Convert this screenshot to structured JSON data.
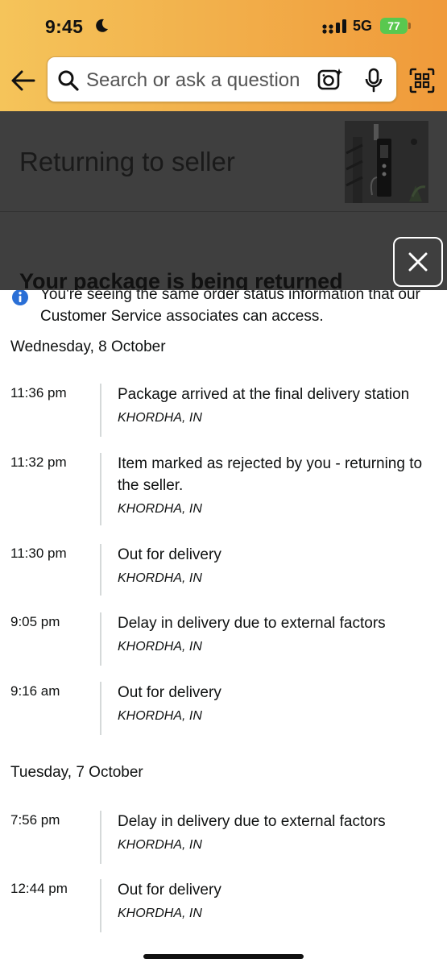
{
  "status_bar": {
    "time": "9:45",
    "network": "5G",
    "battery": "77"
  },
  "search": {
    "placeholder": "Search or ask a question"
  },
  "page": {
    "title": "Returning to seller"
  },
  "modal": {
    "title": "Your package is being returned",
    "info_text": "You're seeing the same order status information that our Customer Service associates can access."
  },
  "timeline": [
    {
      "day": "Wednesday, 8 October",
      "events": [
        {
          "time": "11:36 pm",
          "description": "Package arrived at the final delivery station",
          "location": "KHORDHA, IN"
        },
        {
          "time": "11:32 pm",
          "description": "Item marked as rejected by you - returning to the seller.",
          "location": "KHORDHA, IN"
        },
        {
          "time": "11:30 pm",
          "description": "Out for delivery",
          "location": "KHORDHA, IN"
        },
        {
          "time": "9:05 pm",
          "description": "Delay in delivery due to external factors",
          "location": "KHORDHA, IN"
        },
        {
          "time": "9:16 am",
          "description": "Out for delivery",
          "location": "KHORDHA, IN"
        }
      ]
    },
    {
      "day": "Tuesday, 7 October",
      "events": [
        {
          "time": "7:56 pm",
          "description": "Delay in delivery due to external factors",
          "location": "KHORDHA, IN"
        },
        {
          "time": "12:44 pm",
          "description": "Out for delivery",
          "location": "KHORDHA, IN"
        }
      ]
    }
  ],
  "icons": {
    "back": "back-arrow-icon",
    "search": "search-icon",
    "camera": "camera-lens-icon",
    "mic": "microphone-icon",
    "qr": "qr-scan-icon",
    "close": "close-icon",
    "info": "info-icon"
  },
  "colors": {
    "header_gradient_start": "#f5c45a",
    "header_gradient_end": "#f09a3a",
    "info_blue": "#2a6fd6",
    "battery_green": "#59c84f"
  }
}
